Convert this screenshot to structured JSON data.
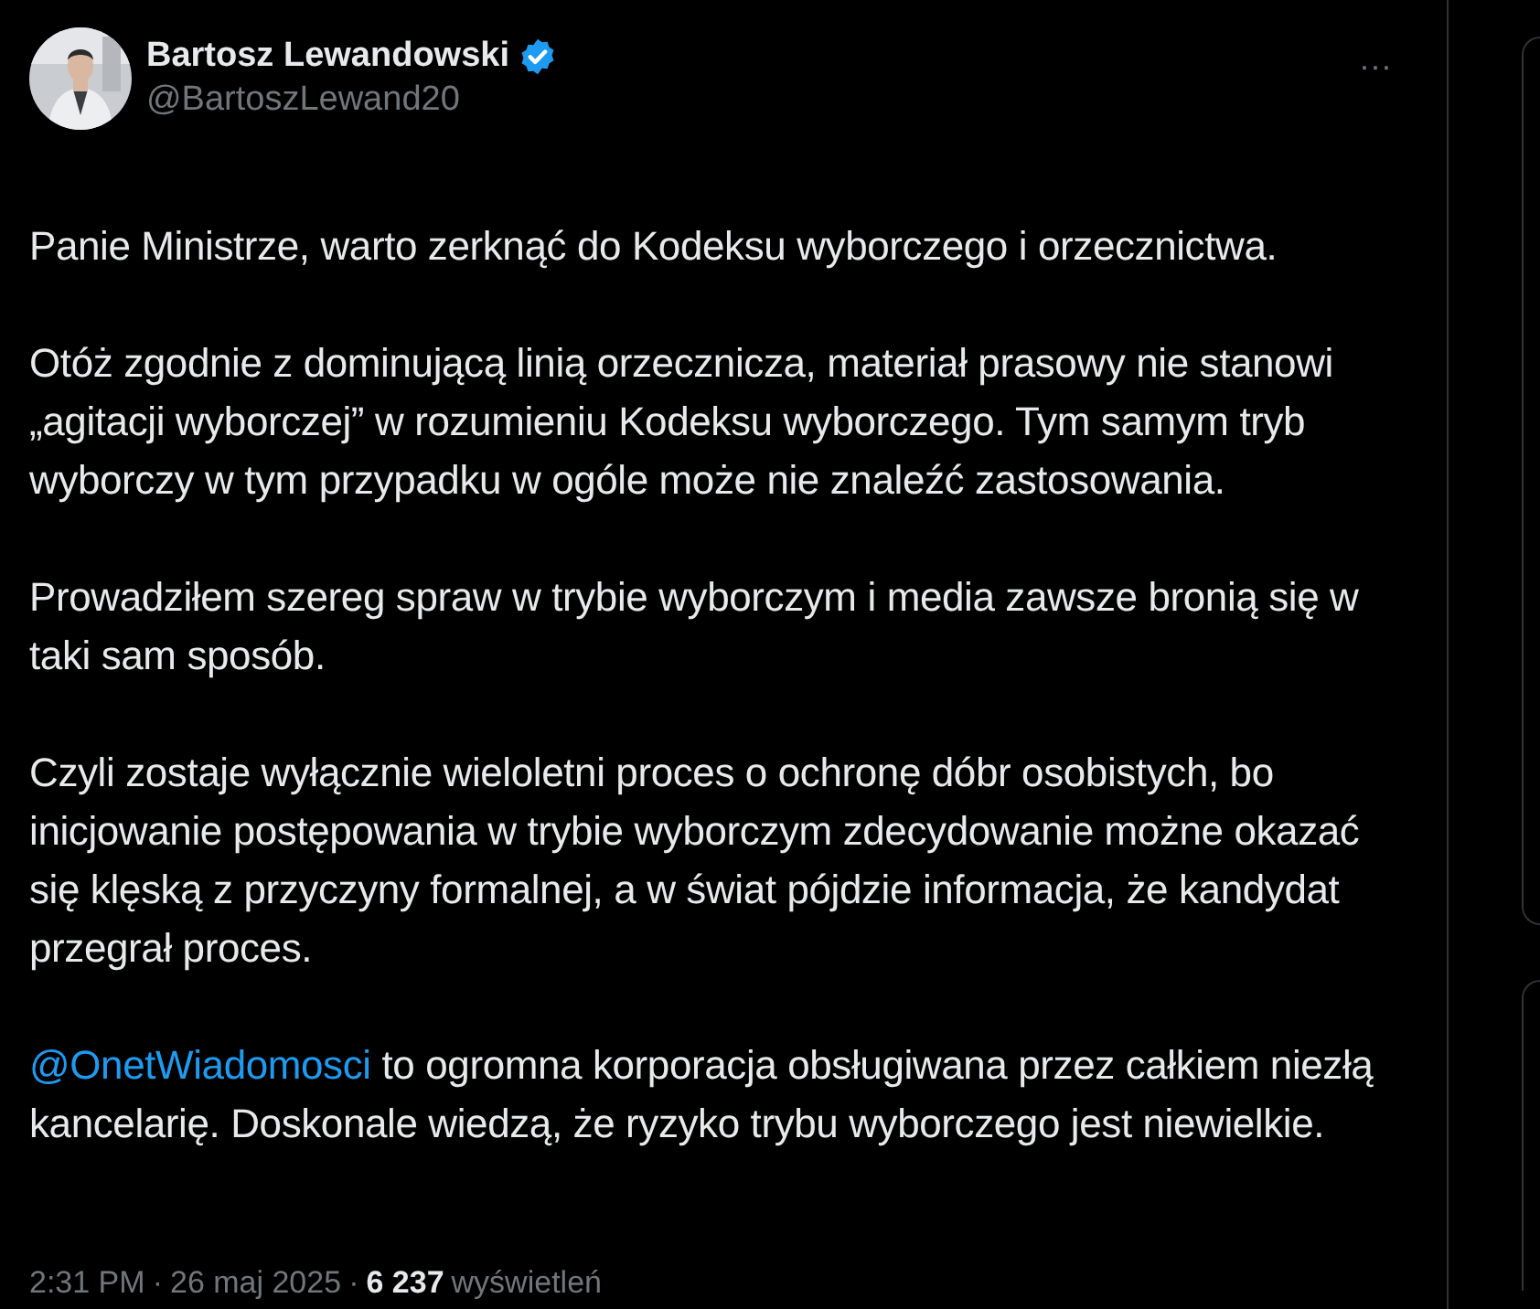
{
  "author": {
    "name": "Bartosz Lewandowski",
    "verified": true,
    "handle": "@BartoszLewand20"
  },
  "more_button": "···",
  "paragraphs": [
    {
      "text": "Panie Ministrze, warto zerknąć do Kodeksu wyborczego i orzecznictwa."
    },
    {
      "text": "Otóż zgodnie z dominującą linią orzecznicza, materiał prasowy nie stanowi „agitacji wyborczej” w rozumieniu Kodeksu wyborczego. Tym samym tryb wyborczy w tym przypadku w ogóle może nie znaleźć zastosowania."
    },
    {
      "text": "Prowadziłem szereg spraw w trybie wyborczym i media zawsze bronią się w taki sam sposób."
    },
    {
      "text": "Czyli zostaje wyłącznie wieloletni proces o ochronę dóbr osobistych, bo inicjowanie postępowania w trybie wyborczym zdecydowanie możne okazać się klęską z przyczyny formalnej, a w świat pójdzie informacja, że kandydat przegrał proces."
    },
    {
      "mention": "@OnetWiadomosci",
      "text": "to ogromna korporacja obsługiwana przez całkiem niezłą kancelarię. Doskonale wiedzą, że ryzyko trybu wyborczego jest niewielkie."
    }
  ],
  "meta": {
    "time": "2:31 PM",
    "separator_1": "·",
    "date": "26 maj 2025",
    "separator_2": "·",
    "views": "6 237",
    "views_label": "wyświetleń"
  }
}
